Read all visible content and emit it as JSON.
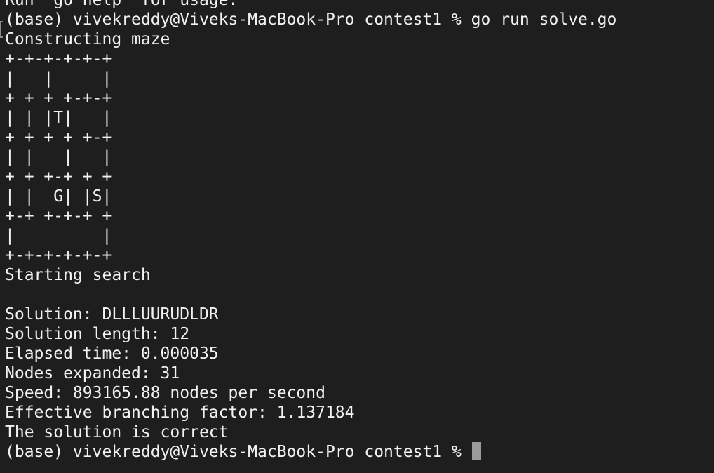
{
  "terminal": {
    "lines": [
      "Run 'go help' for usage.",
      "(base) vivekreddy@Viveks-MacBook-Pro contest1 % go run solve.go",
      "Constructing maze",
      "+-+-+-+-+-+",
      "|   |     |",
      "+ + + +-+-+",
      "| | |T|   |",
      "+ + + + +-+",
      "| |   |   |",
      "+ + +-+ + +",
      "| |  G| |S|",
      "+-+ +-+-+ +",
      "|         |",
      "+-+-+-+-+-+",
      "Starting search",
      "",
      "Solution: DLLLUURUDLDR",
      "Solution length: 12",
      "Elapsed time: 0.000035",
      "Nodes expanded: 31",
      "Speed: 893165.88 nodes per second",
      "Effective branching factor: 1.137184",
      "The solution is correct"
    ],
    "prompt": "(base) vivekreddy@Viveks-MacBook-Pro contest1 % "
  },
  "colors": {
    "background": "#1e1e1e",
    "text": "#f2f2f2",
    "cursor": "#9b9b9b"
  }
}
